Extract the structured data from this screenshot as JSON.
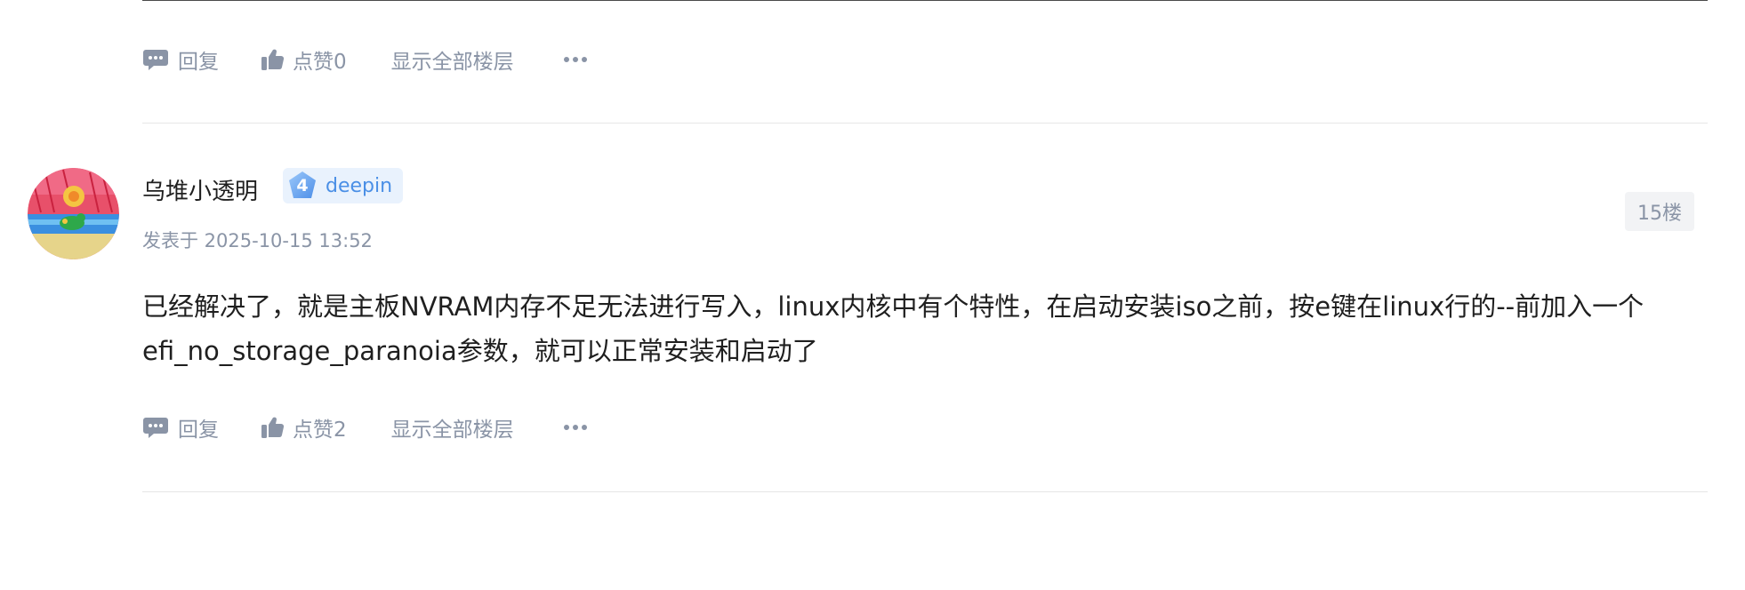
{
  "colors": {
    "muted": "#8a94a6",
    "badge_bg": "#e9f2fd",
    "badge_accent": "#4a8fe6",
    "floor_bg": "#f2f3f5",
    "text": "#1f1f1f"
  },
  "prev_post_actions": {
    "reply_icon": "comment-icon",
    "reply_label": "回复",
    "like_icon": "thumbs-up-icon",
    "like_label": "点赞0",
    "show_all_label": "显示全部楼层",
    "more_icon": "more-dots-icon"
  },
  "post": {
    "author": "乌堆小透明",
    "badge": {
      "level": "4",
      "label": "deepin"
    },
    "posted_at": "发表于 2025-10-15 13:52",
    "floor": "15楼",
    "content": "已经解决了，就是主板NVRAM内存不足无法进行写入，linux内核中有个特性，在启动安装iso之前，按e键在linux行的--前加入一个efi_no_storage_paranoia参数，就可以正常安装和启动了",
    "actions": {
      "reply_icon": "comment-icon",
      "reply_label": "回复",
      "like_icon": "thumbs-up-icon",
      "like_label": "点赞2",
      "show_all_label": "显示全部楼层",
      "more_icon": "more-dots-icon"
    }
  }
}
